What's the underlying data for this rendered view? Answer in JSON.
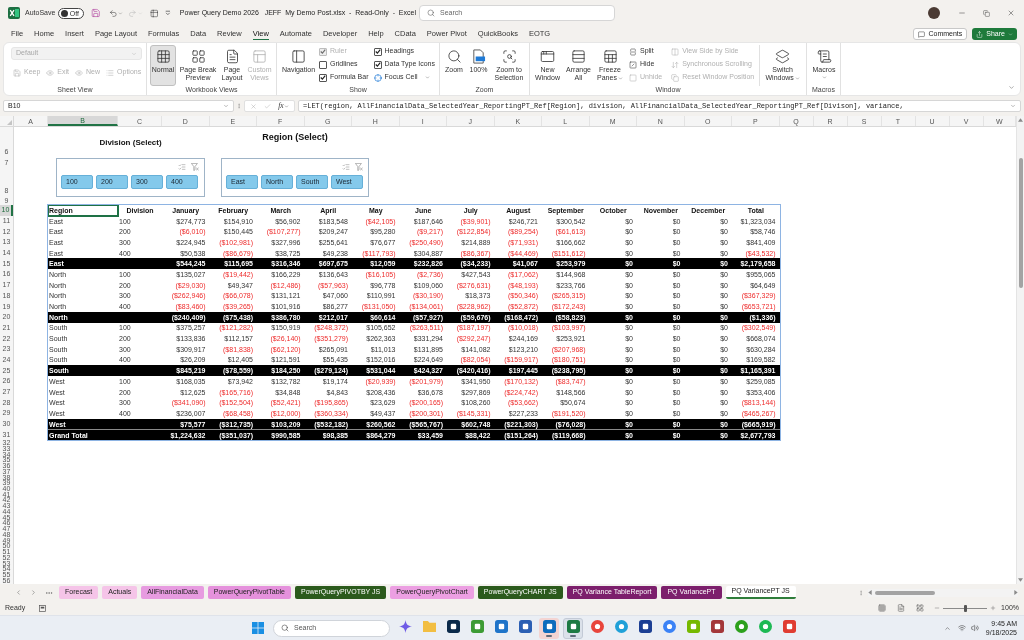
{
  "title_bar": {
    "autosave": {
      "label": "AutoSave",
      "on": false,
      "state_label": "Off"
    },
    "title": "Power Query Demo 2026   JEFF  My Demo Post.xlsx  -  Read-Only  -  Excel",
    "search_placeholder": "Search"
  },
  "menu_tabs": [
    {
      "label": "File",
      "selected": false
    },
    {
      "label": "Home",
      "selected": false
    },
    {
      "label": "Insert",
      "selected": false
    },
    {
      "label": "Page Layout",
      "selected": false
    },
    {
      "label": "Formulas",
      "selected": false
    },
    {
      "label": "Data",
      "selected": false
    },
    {
      "label": "Review",
      "selected": false
    },
    {
      "label": "View",
      "selected": true
    },
    {
      "label": "Automate",
      "selected": false
    },
    {
      "label": "Developer",
      "selected": false
    },
    {
      "label": "Help",
      "selected": false
    },
    {
      "label": "CData",
      "selected": false
    },
    {
      "label": "Power Pivot",
      "selected": false
    },
    {
      "label": "QuickBooks",
      "selected": false
    },
    {
      "label": "EOTG",
      "selected": false
    }
  ],
  "header_buttons": {
    "comments": "Comments",
    "share": "Share"
  },
  "ribbon": {
    "sheet_view": {
      "label": "Sheet View",
      "view_select": {
        "value": "Default",
        "disabled": true
      },
      "buttons": [
        {
          "label": "Keep",
          "disabled": true
        },
        {
          "label": "Exit",
          "disabled": true
        },
        {
          "label": "New",
          "disabled": true
        },
        {
          "label": "Options",
          "disabled": true
        }
      ]
    },
    "workbook_views": {
      "label": "Workbook Views",
      "buttons": [
        {
          "label": "Normal",
          "selected": true,
          "disabled": false
        },
        {
          "label": "Page Break Preview",
          "selected": false,
          "disabled": false
        },
        {
          "label": "Page Layout",
          "selected": false,
          "disabled": false
        },
        {
          "label": "Custom Views",
          "selected": false,
          "disabled": true
        }
      ]
    },
    "show": {
      "label": "Show",
      "navigation": "Navigation",
      "checkboxes": [
        {
          "label": "Ruler",
          "checked": true,
          "disabled": true
        },
        {
          "label": "Gridlines",
          "checked": false,
          "disabled": false
        },
        {
          "label": "Formula Bar",
          "checked": true,
          "disabled": false
        },
        {
          "label": "Headings",
          "checked": true,
          "disabled": false
        },
        {
          "label": "Data Type Icons",
          "checked": true,
          "disabled": false
        }
      ],
      "focus_cell": {
        "label": "Focus Cell",
        "dropdown": true
      }
    },
    "zoom": {
      "label": "Zoom",
      "buttons": [
        "Zoom",
        "100%",
        "Zoom to Selection"
      ]
    },
    "window": {
      "label": "Window",
      "large_buttons": [
        {
          "label": "New Window",
          "dropdown": false
        },
        {
          "label": "Arrange All",
          "dropdown": false
        },
        {
          "label": "Freeze Panes",
          "dropdown": true
        }
      ],
      "small_buttons": [
        {
          "label": "Split",
          "disabled": false
        },
        {
          "label": "Hide",
          "disabled": false
        },
        {
          "label": "Unhide",
          "disabled": true
        }
      ],
      "side_buttons": [
        {
          "label": "View Side by Side",
          "disabled": true
        },
        {
          "label": "Synchronous Scrolling",
          "disabled": true
        },
        {
          "label": "Reset Window Position",
          "disabled": true
        }
      ],
      "switch": {
        "label": "Switch Windows",
        "dropdown": true
      }
    },
    "macros": {
      "label": "Macros",
      "button": {
        "label": "Macros",
        "dropdown": true
      }
    }
  },
  "formula_bar": {
    "name_box": "B10",
    "function_label": "fx",
    "formula": "=LET(region, AllFinancialData_SelectedYear_ReportingPT_Ref[Region], division, AllFinancialData_SelectedYear_ReportingPT_Ref[Divison], variance,"
  },
  "sheet": {
    "columns": [
      {
        "label": "A",
        "selected": false
      },
      {
        "label": "B",
        "selected": true
      },
      {
        "label": "C",
        "selected": false
      },
      {
        "label": "D",
        "selected": false
      },
      {
        "label": "E",
        "selected": false
      },
      {
        "label": "F",
        "selected": false
      },
      {
        "label": "G",
        "selected": false
      },
      {
        "label": "H",
        "selected": false
      },
      {
        "label": "I",
        "selected": false
      },
      {
        "label": "J",
        "selected": false
      },
      {
        "label": "K",
        "selected": false
      },
      {
        "label": "L",
        "selected": false
      },
      {
        "label": "M",
        "selected": false
      },
      {
        "label": "N",
        "selected": false
      },
      {
        "label": "O",
        "selected": false
      },
      {
        "label": "P",
        "selected": false
      },
      {
        "label": "Q",
        "selected": false
      },
      {
        "label": "R",
        "selected": false
      },
      {
        "label": "S",
        "selected": false
      },
      {
        "label": "T",
        "selected": false
      },
      {
        "label": "U",
        "selected": false
      },
      {
        "label": "V",
        "selected": false
      },
      {
        "label": "W",
        "selected": false
      }
    ],
    "rows": [
      {
        "label": "6",
        "selected": false
      },
      {
        "label": "7",
        "selected": false
      },
      {
        "label": "8",
        "selected": false
      },
      {
        "label": "9",
        "selected": false
      },
      {
        "label": "10",
        "selected": true
      },
      {
        "label": "11",
        "selected": false
      },
      {
        "label": "12",
        "selected": false
      },
      {
        "label": "13",
        "selected": false
      },
      {
        "label": "14",
        "selected": false
      },
      {
        "label": "15",
        "selected": false
      },
      {
        "label": "16",
        "selected": false
      },
      {
        "label": "17",
        "selected": false
      },
      {
        "label": "18",
        "selected": false
      },
      {
        "label": "19",
        "selected": false
      },
      {
        "label": "20",
        "selected": false
      },
      {
        "label": "21",
        "selected": false
      },
      {
        "label": "22",
        "selected": false
      },
      {
        "label": "23",
        "selected": false
      },
      {
        "label": "24",
        "selected": false
      },
      {
        "label": "25",
        "selected": false
      },
      {
        "label": "26",
        "selected": false
      },
      {
        "label": "27",
        "selected": false
      },
      {
        "label": "28",
        "selected": false
      },
      {
        "label": "29",
        "selected": false
      },
      {
        "label": "30",
        "selected": false
      },
      {
        "label": "31",
        "selected": false
      },
      {
        "label": "32",
        "selected": false
      },
      {
        "label": "33",
        "selected": false
      },
      {
        "label": "34",
        "selected": false
      },
      {
        "label": "35",
        "selected": false
      },
      {
        "label": "36",
        "selected": false
      },
      {
        "label": "37",
        "selected": false
      },
      {
        "label": "38",
        "selected": false
      },
      {
        "label": "39",
        "selected": false
      },
      {
        "label": "40",
        "selected": false
      },
      {
        "label": "41",
        "selected": false
      },
      {
        "label": "42",
        "selected": false
      },
      {
        "label": "43",
        "selected": false
      },
      {
        "label": "44",
        "selected": false
      },
      {
        "label": "45",
        "selected": false
      },
      {
        "label": "46",
        "selected": false
      },
      {
        "label": "47",
        "selected": false
      },
      {
        "label": "48",
        "selected": false
      },
      {
        "label": "49",
        "selected": false
      },
      {
        "label": "50",
        "selected": false
      },
      {
        "label": "51",
        "selected": false
      },
      {
        "label": "52",
        "selected": false
      },
      {
        "label": "53",
        "selected": false
      },
      {
        "label": "54",
        "selected": false
      },
      {
        "label": "55",
        "selected": false
      },
      {
        "label": "56",
        "selected": false
      }
    ]
  },
  "slicers": [
    {
      "title": "Division (Select)",
      "items": [
        {
          "label": "100",
          "selected": true
        },
        {
          "label": "200",
          "selected": true
        },
        {
          "label": "300",
          "selected": true
        },
        {
          "label": "400",
          "selected": true
        }
      ]
    },
    {
      "title": "Region (Select)",
      "items": [
        {
          "label": "East",
          "selected": true
        },
        {
          "label": "North",
          "selected": true
        },
        {
          "label": "South",
          "selected": true
        },
        {
          "label": "West",
          "selected": true
        }
      ]
    }
  ],
  "table": {
    "columns": [
      {
        "label": "Region",
        "selected": true
      },
      {
        "label": "Division",
        "selected": false
      },
      {
        "label": "January",
        "selected": false
      },
      {
        "label": "February",
        "selected": false
      },
      {
        "label": "March",
        "selected": false
      },
      {
        "label": "April",
        "selected": false
      },
      {
        "label": "May",
        "selected": false
      },
      {
        "label": "June",
        "selected": false
      },
      {
        "label": "July",
        "selected": false
      },
      {
        "label": "August",
        "selected": false
      },
      {
        "label": "September",
        "selected": false
      },
      {
        "label": "October",
        "selected": false
      },
      {
        "label": "November",
        "selected": false
      },
      {
        "label": "December",
        "selected": false
      },
      {
        "label": "Total",
        "selected": false
      }
    ],
    "rows": [
      {
        "kind": "data",
        "cells": [
          {
            "value": "East",
            "negative": false
          },
          {
            "value": "100",
            "negative": false
          },
          {
            "value": "$274,773",
            "negative": false
          },
          {
            "value": "$154,910",
            "negative": false
          },
          {
            "value": "$56,902",
            "negative": false
          },
          {
            "value": "$183,548",
            "negative": false
          },
          {
            "value": "($42,105)",
            "negative": true
          },
          {
            "value": "$187,646",
            "negative": false
          },
          {
            "value": "($39,901)",
            "negative": true
          },
          {
            "value": "$246,721",
            "negative": false
          },
          {
            "value": "$300,542",
            "negative": false
          },
          {
            "value": "$0",
            "negative": false
          },
          {
            "value": "$0",
            "negative": false
          },
          {
            "value": "$0",
            "negative": false
          },
          {
            "value": "$1,323,034",
            "negative": false
          }
        ]
      },
      {
        "kind": "data",
        "cells": [
          {
            "value": "East",
            "negative": false
          },
          {
            "value": "200",
            "negative": false
          },
          {
            "value": "($6,010)",
            "negative": true
          },
          {
            "value": "$150,445",
            "negative": false
          },
          {
            "value": "($107,277)",
            "negative": true
          },
          {
            "value": "$209,247",
            "negative": false
          },
          {
            "value": "$95,280",
            "negative": false
          },
          {
            "value": "($9,217)",
            "negative": true
          },
          {
            "value": "($122,854)",
            "negative": true
          },
          {
            "value": "($89,254)",
            "negative": true
          },
          {
            "value": "($61,613)",
            "negative": true
          },
          {
            "value": "$0",
            "negative": false
          },
          {
            "value": "$0",
            "negative": false
          },
          {
            "value": "$0",
            "negative": false
          },
          {
            "value": "$58,746",
            "negative": false
          }
        ]
      },
      {
        "kind": "data",
        "cells": [
          {
            "value": "East",
            "negative": false
          },
          {
            "value": "300",
            "negative": false
          },
          {
            "value": "$224,945",
            "negative": false
          },
          {
            "value": "($102,981)",
            "negative": true
          },
          {
            "value": "$327,996",
            "negative": false
          },
          {
            "value": "$255,641",
            "negative": false
          },
          {
            "value": "$76,677",
            "negative": false
          },
          {
            "value": "($250,490)",
            "negative": true
          },
          {
            "value": "$214,889",
            "negative": false
          },
          {
            "value": "($71,931)",
            "negative": true
          },
          {
            "value": "$166,662",
            "negative": false
          },
          {
            "value": "$0",
            "negative": false
          },
          {
            "value": "$0",
            "negative": false
          },
          {
            "value": "$0",
            "negative": false
          },
          {
            "value": "$841,409",
            "negative": false
          }
        ]
      },
      {
        "kind": "data",
        "cells": [
          {
            "value": "East",
            "negative": false
          },
          {
            "value": "400",
            "negative": false
          },
          {
            "value": "$50,538",
            "negative": false
          },
          {
            "value": "($86,679)",
            "negative": true
          },
          {
            "value": "$38,725",
            "negative": false
          },
          {
            "value": "$49,238",
            "negative": false
          },
          {
            "value": "($117,793)",
            "negative": true
          },
          {
            "value": "$304,887",
            "negative": false
          },
          {
            "value": "($86,367)",
            "negative": true
          },
          {
            "value": "($44,469)",
            "negative": true
          },
          {
            "value": "($151,612)",
            "negative": true
          },
          {
            "value": "$0",
            "negative": false
          },
          {
            "value": "$0",
            "negative": false
          },
          {
            "value": "$0",
            "negative": false
          },
          {
            "value": "($43,532)",
            "negative": true
          }
        ]
      },
      {
        "kind": "subtotal",
        "cells": [
          "East",
          "",
          "$544,245",
          "$115,695",
          "$316,346",
          "$697,675",
          "$12,059",
          "$232,826",
          "($34,233)",
          "$41,067",
          "$253,979",
          "$0",
          "$0",
          "$0",
          "$2,179,658"
        ]
      },
      {
        "kind": "data",
        "cells": [
          {
            "value": "North",
            "negative": false
          },
          {
            "value": "100",
            "negative": false
          },
          {
            "value": "$135,027",
            "negative": false
          },
          {
            "value": "($19,442)",
            "negative": true
          },
          {
            "value": "$166,229",
            "negative": false
          },
          {
            "value": "$136,643",
            "negative": false
          },
          {
            "value": "($16,105)",
            "negative": true
          },
          {
            "value": "($2,736)",
            "negative": true
          },
          {
            "value": "$427,543",
            "negative": false
          },
          {
            "value": "($17,062)",
            "negative": true
          },
          {
            "value": "$144,968",
            "negative": false
          },
          {
            "value": "$0",
            "negative": false
          },
          {
            "value": "$0",
            "negative": false
          },
          {
            "value": "$0",
            "negative": false
          },
          {
            "value": "$955,065",
            "negative": false
          }
        ]
      },
      {
        "kind": "data",
        "cells": [
          {
            "value": "North",
            "negative": false
          },
          {
            "value": "200",
            "negative": false
          },
          {
            "value": "($29,030)",
            "negative": true
          },
          {
            "value": "$49,347",
            "negative": false
          },
          {
            "value": "($12,486)",
            "negative": true
          },
          {
            "value": "($57,963)",
            "negative": true
          },
          {
            "value": "$96,778",
            "negative": false
          },
          {
            "value": "$109,060",
            "negative": false
          },
          {
            "value": "($276,631)",
            "negative": true
          },
          {
            "value": "($48,193)",
            "negative": true
          },
          {
            "value": "$233,766",
            "negative": false
          },
          {
            "value": "$0",
            "negative": false
          },
          {
            "value": "$0",
            "negative": false
          },
          {
            "value": "$0",
            "negative": false
          },
          {
            "value": "$64,649",
            "negative": false
          }
        ]
      },
      {
        "kind": "data",
        "cells": [
          {
            "value": "North",
            "negative": false
          },
          {
            "value": "300",
            "negative": false
          },
          {
            "value": "($262,946)",
            "negative": true
          },
          {
            "value": "($66,078)",
            "negative": true
          },
          {
            "value": "$131,121",
            "negative": false
          },
          {
            "value": "$47,060",
            "negative": false
          },
          {
            "value": "$110,991",
            "negative": false
          },
          {
            "value": "($30,190)",
            "negative": true
          },
          {
            "value": "$18,373",
            "negative": false
          },
          {
            "value": "($50,346)",
            "negative": true
          },
          {
            "value": "($265,315)",
            "negative": true
          },
          {
            "value": "$0",
            "negative": false
          },
          {
            "value": "$0",
            "negative": false
          },
          {
            "value": "$0",
            "negative": false
          },
          {
            "value": "($367,329)",
            "negative": true
          }
        ]
      },
      {
        "kind": "data",
        "cells": [
          {
            "value": "North",
            "negative": false
          },
          {
            "value": "400",
            "negative": false
          },
          {
            "value": "($83,460)",
            "negative": true
          },
          {
            "value": "($39,265)",
            "negative": true
          },
          {
            "value": "$101,916",
            "negative": false
          },
          {
            "value": "$86,277",
            "negative": false
          },
          {
            "value": "($131,050)",
            "negative": true
          },
          {
            "value": "($134,061)",
            "negative": true
          },
          {
            "value": "($228,962)",
            "negative": true
          },
          {
            "value": "($52,872)",
            "negative": true
          },
          {
            "value": "($172,243)",
            "negative": true
          },
          {
            "value": "$0",
            "negative": false
          },
          {
            "value": "$0",
            "negative": false
          },
          {
            "value": "$0",
            "negative": false
          },
          {
            "value": "($653,721)",
            "negative": true
          }
        ]
      },
      {
        "kind": "subtotal",
        "cells": [
          "North",
          "",
          "($240,409)",
          "($75,438)",
          "$386,780",
          "$212,017",
          "$60,614",
          "($57,927)",
          "($59,676)",
          "($168,472)",
          "($58,823)",
          "$0",
          "$0",
          "$0",
          "($1,336)"
        ]
      },
      {
        "kind": "data",
        "cells": [
          {
            "value": "South",
            "negative": false
          },
          {
            "value": "100",
            "negative": false
          },
          {
            "value": "$375,257",
            "negative": false
          },
          {
            "value": "($121,282)",
            "negative": true
          },
          {
            "value": "$150,919",
            "negative": false
          },
          {
            "value": "($248,372)",
            "negative": true
          },
          {
            "value": "$105,652",
            "negative": false
          },
          {
            "value": "($263,511)",
            "negative": true
          },
          {
            "value": "($187,197)",
            "negative": true
          },
          {
            "value": "($10,018)",
            "negative": true
          },
          {
            "value": "($103,997)",
            "negative": true
          },
          {
            "value": "$0",
            "negative": false
          },
          {
            "value": "$0",
            "negative": false
          },
          {
            "value": "$0",
            "negative": false
          },
          {
            "value": "($302,549)",
            "negative": true
          }
        ]
      },
      {
        "kind": "data",
        "cells": [
          {
            "value": "South",
            "negative": false
          },
          {
            "value": "200",
            "negative": false
          },
          {
            "value": "$133,836",
            "negative": false
          },
          {
            "value": "$112,157",
            "negative": false
          },
          {
            "value": "($26,140)",
            "negative": true
          },
          {
            "value": "($351,279)",
            "negative": true
          },
          {
            "value": "$262,363",
            "negative": false
          },
          {
            "value": "$331,294",
            "negative": false
          },
          {
            "value": "($292,247)",
            "negative": true
          },
          {
            "value": "$244,169",
            "negative": false
          },
          {
            "value": "$253,921",
            "negative": false
          },
          {
            "value": "$0",
            "negative": false
          },
          {
            "value": "$0",
            "negative": false
          },
          {
            "value": "$0",
            "negative": false
          },
          {
            "value": "$668,074",
            "negative": false
          }
        ]
      },
      {
        "kind": "data",
        "cells": [
          {
            "value": "South",
            "negative": false
          },
          {
            "value": "300",
            "negative": false
          },
          {
            "value": "$309,917",
            "negative": false
          },
          {
            "value": "($81,838)",
            "negative": true
          },
          {
            "value": "($62,120)",
            "negative": true
          },
          {
            "value": "$265,091",
            "negative": false
          },
          {
            "value": "$11,013",
            "negative": false
          },
          {
            "value": "$131,895",
            "negative": false
          },
          {
            "value": "$141,082",
            "negative": false
          },
          {
            "value": "$123,210",
            "negative": false
          },
          {
            "value": "($207,968)",
            "negative": true
          },
          {
            "value": "$0",
            "negative": false
          },
          {
            "value": "$0",
            "negative": false
          },
          {
            "value": "$0",
            "negative": false
          },
          {
            "value": "$630,284",
            "negative": false
          }
        ]
      },
      {
        "kind": "data",
        "cells": [
          {
            "value": "South",
            "negative": false
          },
          {
            "value": "400",
            "negative": false
          },
          {
            "value": "$26,209",
            "negative": false
          },
          {
            "value": "$12,405",
            "negative": false
          },
          {
            "value": "$121,591",
            "negative": false
          },
          {
            "value": "$55,435",
            "negative": false
          },
          {
            "value": "$152,016",
            "negative": false
          },
          {
            "value": "$224,649",
            "negative": false
          },
          {
            "value": "($82,054)",
            "negative": true
          },
          {
            "value": "($159,917)",
            "negative": true
          },
          {
            "value": "($180,751)",
            "negative": true
          },
          {
            "value": "$0",
            "negative": false
          },
          {
            "value": "$0",
            "negative": false
          },
          {
            "value": "$0",
            "negative": false
          },
          {
            "value": "$169,582",
            "negative": false
          }
        ]
      },
      {
        "kind": "subtotal",
        "cells": [
          "South",
          "",
          "$845,219",
          "($78,559)",
          "$184,250",
          "($279,124)",
          "$531,044",
          "$424,327",
          "($420,416)",
          "$197,445",
          "($238,795)",
          "$0",
          "$0",
          "$0",
          "$1,165,391"
        ]
      },
      {
        "kind": "data",
        "cells": [
          {
            "value": "West",
            "negative": false
          },
          {
            "value": "100",
            "negative": false
          },
          {
            "value": "$168,035",
            "negative": false
          },
          {
            "value": "$73,942",
            "negative": false
          },
          {
            "value": "$132,782",
            "negative": false
          },
          {
            "value": "$19,174",
            "negative": false
          },
          {
            "value": "($20,939)",
            "negative": true
          },
          {
            "value": "($201,979)",
            "negative": true
          },
          {
            "value": "$341,950",
            "negative": false
          },
          {
            "value": "($170,132)",
            "negative": true
          },
          {
            "value": "($83,747)",
            "negative": true
          },
          {
            "value": "$0",
            "negative": false
          },
          {
            "value": "$0",
            "negative": false
          },
          {
            "value": "$0",
            "negative": false
          },
          {
            "value": "$259,085",
            "negative": false
          }
        ]
      },
      {
        "kind": "data",
        "cells": [
          {
            "value": "West",
            "negative": false
          },
          {
            "value": "200",
            "negative": false
          },
          {
            "value": "$12,625",
            "negative": false
          },
          {
            "value": "($165,716)",
            "negative": true
          },
          {
            "value": "$34,848",
            "negative": false
          },
          {
            "value": "$4,843",
            "negative": false
          },
          {
            "value": "$208,436",
            "negative": false
          },
          {
            "value": "$36,678",
            "negative": false
          },
          {
            "value": "$297,869",
            "negative": false
          },
          {
            "value": "($224,742)",
            "negative": true
          },
          {
            "value": "$148,566",
            "negative": false
          },
          {
            "value": "$0",
            "negative": false
          },
          {
            "value": "$0",
            "negative": false
          },
          {
            "value": "$0",
            "negative": false
          },
          {
            "value": "$353,406",
            "negative": false
          }
        ]
      },
      {
        "kind": "data",
        "cells": [
          {
            "value": "West",
            "negative": false
          },
          {
            "value": "300",
            "negative": false
          },
          {
            "value": "($341,090)",
            "negative": true
          },
          {
            "value": "($152,504)",
            "negative": true
          },
          {
            "value": "($52,421)",
            "negative": true
          },
          {
            "value": "($195,865)",
            "negative": true
          },
          {
            "value": "$23,629",
            "negative": false
          },
          {
            "value": "($200,165)",
            "negative": true
          },
          {
            "value": "$108,260",
            "negative": false
          },
          {
            "value": "($53,662)",
            "negative": true
          },
          {
            "value": "$50,674",
            "negative": false
          },
          {
            "value": "$0",
            "negative": false
          },
          {
            "value": "$0",
            "negative": false
          },
          {
            "value": "$0",
            "negative": false
          },
          {
            "value": "($813,144)",
            "negative": true
          }
        ]
      },
      {
        "kind": "data",
        "cells": [
          {
            "value": "West",
            "negative": false
          },
          {
            "value": "400",
            "negative": false
          },
          {
            "value": "$236,007",
            "negative": false
          },
          {
            "value": "($68,458)",
            "negative": true
          },
          {
            "value": "($12,000)",
            "negative": true
          },
          {
            "value": "($360,334)",
            "negative": true
          },
          {
            "value": "$49,437",
            "negative": false
          },
          {
            "value": "($200,301)",
            "negative": true
          },
          {
            "value": "($145,331)",
            "negative": true
          },
          {
            "value": "$227,233",
            "negative": false
          },
          {
            "value": "($191,520)",
            "negative": true
          },
          {
            "value": "$0",
            "negative": false
          },
          {
            "value": "$0",
            "negative": false
          },
          {
            "value": "$0",
            "negative": false
          },
          {
            "value": "($465,267)",
            "negative": true
          }
        ]
      },
      {
        "kind": "subtotal",
        "cells": [
          "West",
          "",
          "$75,577",
          "($312,735)",
          "$103,209",
          "($532,182)",
          "$260,562",
          "($565,767)",
          "$602,748",
          "($221,303)",
          "($76,028)",
          "$0",
          "$0",
          "$0",
          "($665,919)"
        ]
      },
      {
        "kind": "grand_total",
        "cells": [
          "Grand Total",
          "",
          "$1,224,632",
          "($351,037)",
          "$990,585",
          "$98,385",
          "$864,279",
          "$33,459",
          "$88,422",
          "($151,264)",
          "($119,668)",
          "$0",
          "$0",
          "$0",
          "$2,677,793"
        ]
      }
    ]
  },
  "sheet_tabs": [
    {
      "label": "Forecast",
      "color": "#f5c4e8",
      "selected": false
    },
    {
      "label": "Actuals",
      "color": "#f5c4e8",
      "selected": false
    },
    {
      "label": "AllFinancialData",
      "color": "#e79be0",
      "selected": false
    },
    {
      "label": "PowerQueryPivotTable",
      "color": "#e591dc",
      "selected": false
    },
    {
      "label": "PowerQueryPIVOTBY JS",
      "color": "#2b5a1c",
      "selected": false
    },
    {
      "label": "PowerQueryPivotChart",
      "color": "#ec9fe2",
      "selected": false
    },
    {
      "label": "PowerQueryCHART JS",
      "color": "#2b5a1c",
      "selected": false
    },
    {
      "label": "PQ Variance TableReport",
      "color": "#7c1f6c",
      "selected": false
    },
    {
      "label": "PQ VariancePT",
      "color": "#7c1f6c",
      "selected": false
    },
    {
      "label": "PQ VariancePT JS",
      "color": "#2e7d3a",
      "selected": true
    }
  ],
  "status_bar": {
    "status": "Ready",
    "zoom": {
      "level": 0.5,
      "reading": "100%"
    }
  },
  "taskbar": {
    "search_placeholder": "Search",
    "apps": [
      {
        "kind": "sparkle",
        "color": "#6f5ce6",
        "running": false,
        "selected": false,
        "flashing": false
      },
      {
        "kind": "folder",
        "color": "#f2be42",
        "running": false,
        "selected": false,
        "flashing": false
      },
      {
        "kind": "tile",
        "color": "#0b2a4a",
        "running": false,
        "selected": false,
        "flashing": false
      },
      {
        "kind": "tile",
        "color": "#3d9b35",
        "running": false,
        "selected": false,
        "flashing": false
      },
      {
        "kind": "tile",
        "color": "#1f74c9",
        "running": false,
        "selected": false,
        "flashing": false
      },
      {
        "kind": "tile",
        "color": "#2b5fb4",
        "running": false,
        "selected": false,
        "flashing": false
      },
      {
        "kind": "tile",
        "color": "#0f6cbd",
        "running": true,
        "selected": false,
        "flashing": true
      },
      {
        "kind": "tile",
        "color": "#1d7a43",
        "running": true,
        "selected": true,
        "flashing": false
      },
      {
        "kind": "circle",
        "color": "#e8453c",
        "running": false,
        "selected": false,
        "flashing": false
      },
      {
        "kind": "circle",
        "color": "#1fa0d8",
        "running": false,
        "selected": false,
        "flashing": false
      },
      {
        "kind": "tile",
        "color": "#1c3f94",
        "running": false,
        "selected": false,
        "flashing": false
      },
      {
        "kind": "circle",
        "color": "#3b82f6",
        "running": false,
        "selected": false,
        "flashing": false
      },
      {
        "kind": "tile",
        "color": "#76b900",
        "running": false,
        "selected": false,
        "flashing": false
      },
      {
        "kind": "tile",
        "color": "#a4373a",
        "running": false,
        "selected": false,
        "flashing": false
      },
      {
        "kind": "circle",
        "color": "#2ca01c",
        "running": false,
        "selected": false,
        "flashing": false
      },
      {
        "kind": "circle",
        "color": "#1db954",
        "running": false,
        "selected": false,
        "flashing": false
      },
      {
        "kind": "tile",
        "color": "#e03c31",
        "running": false,
        "selected": false,
        "flashing": false
      }
    ],
    "time": "9:45 AM",
    "date": "9/18/2025"
  }
}
